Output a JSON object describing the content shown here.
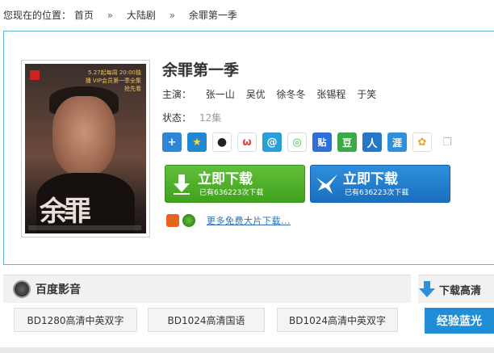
{
  "breadcrumb": {
    "prefix": "您现在的位置：",
    "items": [
      "首页",
      "大陆剧",
      "余罪第一季"
    ],
    "separator": "»"
  },
  "show": {
    "title": "余罪第一季",
    "cast_label": "主演：",
    "cast": [
      "张一山",
      "吴优",
      "徐冬冬",
      "张锡程",
      "于笑"
    ],
    "status_label": "状态：",
    "status_value": "12集"
  },
  "poster": {
    "top_text": "5.27起每周 20:00独播 VIP会员第一季全集抢先看",
    "logo_text": "余罪"
  },
  "share_icons": [
    {
      "name": "plus-share-icon",
      "glyph": "+",
      "color": "#3b8bd8"
    },
    {
      "name": "qzone-star-icon",
      "glyph": "★",
      "color": "#3a9bd8"
    },
    {
      "name": "qq-penguin-icon",
      "glyph": "🐧",
      "color": "#ffffff"
    },
    {
      "name": "weibo-icon",
      "glyph": "ω",
      "color": "#e8453c"
    },
    {
      "name": "tencent-weibo-icon",
      "glyph": "@",
      "color": "#29a0d8"
    },
    {
      "name": "wechat-icon",
      "glyph": "◎",
      "color": "#44b549"
    },
    {
      "name": "tieba-icon",
      "glyph": "贴",
      "color": "#2f6fd8"
    },
    {
      "name": "douban-icon",
      "glyph": "豆",
      "color": "#3bab4a"
    },
    {
      "name": "renren-icon",
      "glyph": "人",
      "color": "#2577c8"
    },
    {
      "name": "huaban-icon",
      "glyph": "涯",
      "color": "#2f8fd8"
    },
    {
      "name": "kaixin-icon",
      "glyph": "✿",
      "color": "#f0a020"
    },
    {
      "name": "copy-icon",
      "glyph": "❐",
      "color": "#e0e0e0"
    }
  ],
  "download": {
    "primary_label": "立即下载",
    "primary_count": "已有636223次下载",
    "secondary_label": "立即下载",
    "secondary_count": "已有636223次下载",
    "green_color": "#4cae27",
    "blue_color": "#2385d0"
  },
  "more": {
    "link_text": "更多免费大片下载..."
  },
  "player": {
    "title": "百度影音"
  },
  "hq": {
    "title": "下载高清"
  },
  "versions": [
    "BD1280高清中英双字",
    "BD1024高清国语",
    "BD1024高清中英双字"
  ],
  "bluray_label": "经验蓝光"
}
